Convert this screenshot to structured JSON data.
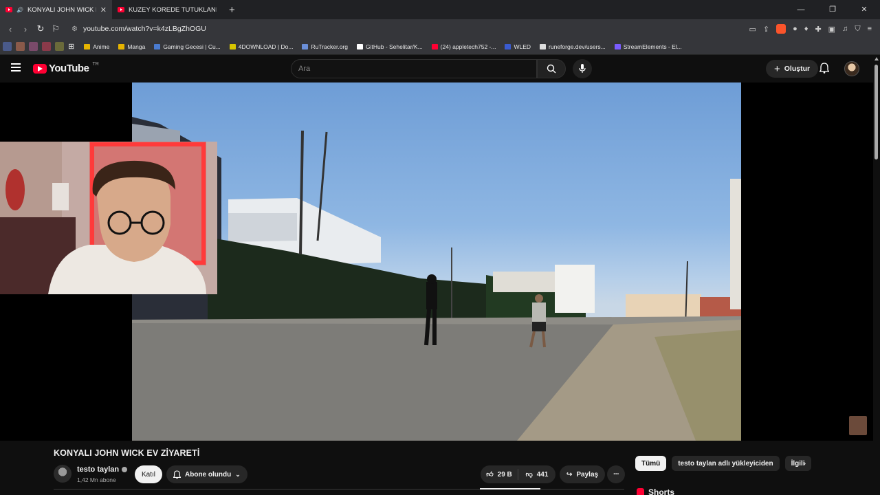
{
  "browser": {
    "tabs": [
      {
        "title": "KONYALI JOHN WICK EV ZİYARETİ",
        "active": true
      },
      {
        "title": "KUZEY KOREDE TUTUKLANIRSANIZ NE OLUR",
        "active": false
      }
    ],
    "address": "youtube.com/watch?v=k4zLBgZhOGU",
    "bookmarks": [
      {
        "label": "Anime",
        "icon": "folder-icon",
        "color": "#e6b400"
      },
      {
        "label": "Manga",
        "icon": "folder-icon",
        "color": "#e6b400"
      },
      {
        "label": "Gaming Gecesi | Cu...",
        "icon": "site-icon",
        "color": "#4a7bd0"
      },
      {
        "label": "4DOWNLOAD | Do...",
        "icon": "site-icon",
        "color": "#d6c400"
      },
      {
        "label": "RuTracker.org",
        "icon": "site-icon",
        "color": "#6b8fd8"
      },
      {
        "label": "GitHub - Sehelitar/K...",
        "icon": "github-icon",
        "color": "#ffffff"
      },
      {
        "label": "(24) appletech752 -...",
        "icon": "youtube-icon",
        "color": "#ff0033"
      },
      {
        "label": "WLED",
        "icon": "site-icon",
        "color": "#3a5bd0"
      },
      {
        "label": "runeforge.dev/users...",
        "icon": "site-icon",
        "color": "#dddddd"
      },
      {
        "label": "StreamElements - El...",
        "icon": "site-icon",
        "color": "#7a5cff"
      }
    ],
    "swatches": [
      "#4a5a8a",
      "#8a5a4a",
      "#7a4a6a",
      "#8a3a4a",
      "#6a6a3a"
    ]
  },
  "header": {
    "logo": "YouTube",
    "region": "TR",
    "search_placeholder": "Ara",
    "create_label": "Oluştur"
  },
  "video": {
    "title": "KONYALI JOHN WICK EV ZİYARETİ",
    "channel": "testo taylan",
    "subscribers": "1,42 Mn abone",
    "join_label": "Katıl",
    "subscribed_label": "Abone olundu",
    "likes": "29 B",
    "dislikes": "441",
    "share_label": "Paylaş"
  },
  "sidebar": {
    "chips": [
      "Tümü",
      "testo taylan adlı yükleyiciden",
      "İlgili"
    ],
    "shorts_label": "Shorts"
  },
  "colors": {
    "background": "#0f0f0f",
    "brand_red": "#ff0033",
    "chip_bg": "#272727"
  }
}
